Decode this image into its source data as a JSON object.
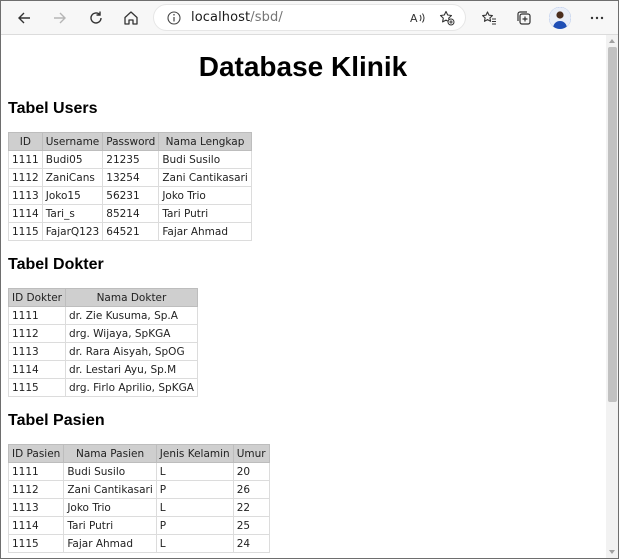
{
  "browser": {
    "url_host": "localhost",
    "url_path": "/sbd/"
  },
  "page": {
    "title": "Database Klinik"
  },
  "users": {
    "heading": "Tabel Users",
    "columns": [
      "ID",
      "Username",
      "Password",
      "Nama Lengkap"
    ],
    "rows": [
      [
        "1111",
        "Budi05",
        "21235",
        "Budi Susilo"
      ],
      [
        "1112",
        "ZaniCans",
        "13254",
        "Zani Cantikasari"
      ],
      [
        "1113",
        "Joko15",
        "56231",
        "Joko Trio"
      ],
      [
        "1114",
        "Tari_s",
        "85214",
        "Tari Putri"
      ],
      [
        "1115",
        "FajarQ123",
        "64521",
        "Fajar Ahmad"
      ]
    ]
  },
  "dokter": {
    "heading": "Tabel Dokter",
    "columns": [
      "ID Dokter",
      "Nama Dokter"
    ],
    "rows": [
      [
        "1111",
        "dr. Zie Kusuma, Sp.A"
      ],
      [
        "1112",
        "drg. Wijaya, SpKGA"
      ],
      [
        "1113",
        "dr. Rara Aisyah, SpOG"
      ],
      [
        "1114",
        "dr. Lestari Ayu, Sp.M"
      ],
      [
        "1115",
        "drg. Firlo Aprilio, SpKGA"
      ]
    ]
  },
  "pasien": {
    "heading": "Tabel Pasien",
    "columns": [
      "ID Pasien",
      "Nama Pasien",
      "Jenis Kelamin",
      "Umur"
    ],
    "rows": [
      [
        "1111",
        "Budi Susilo",
        "L",
        "20"
      ],
      [
        "1112",
        "Zani Cantikasari",
        "P",
        "26"
      ],
      [
        "1113",
        "Joko Trio",
        "L",
        "22"
      ],
      [
        "1114",
        "Tari Putri",
        "P",
        "25"
      ],
      [
        "1115",
        "Fajar Ahmad",
        "L",
        "24"
      ]
    ]
  }
}
